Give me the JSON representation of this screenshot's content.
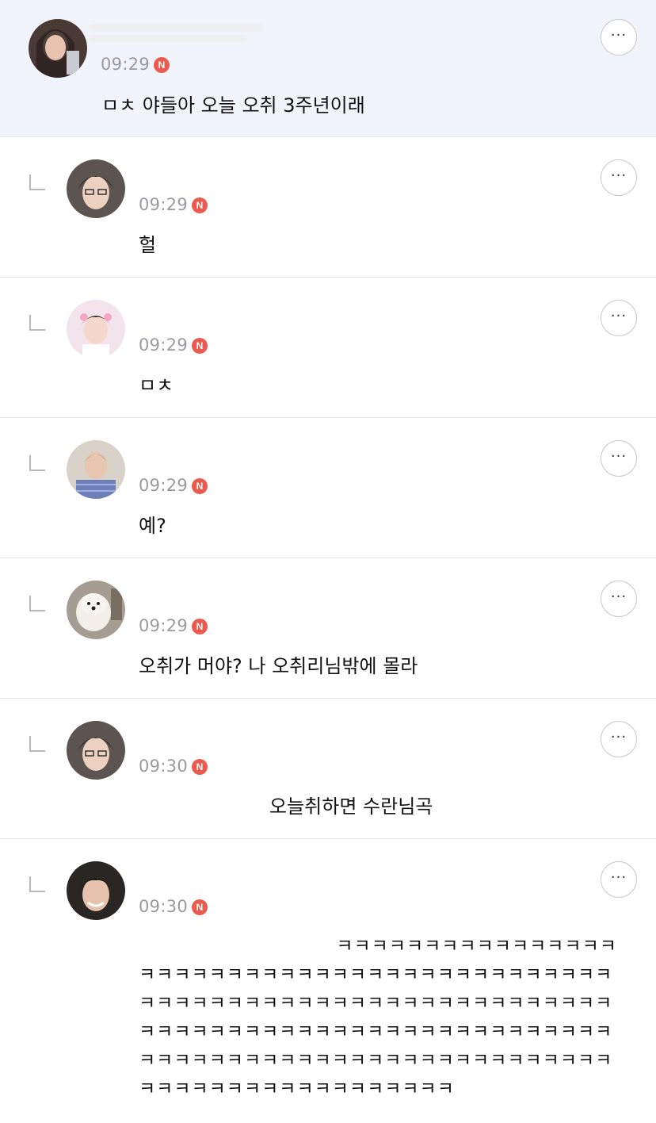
{
  "comments": [
    {
      "time": "09:29",
      "badge": "N",
      "text": "ㅁㅊ 야들아 오늘 오취 3주년이래",
      "more": "···"
    },
    {
      "time": "09:29",
      "badge": "N",
      "text": "헐",
      "more": "···"
    },
    {
      "time": "09:29",
      "badge": "N",
      "text": "ㅁㅊ",
      "more": "···"
    },
    {
      "time": "09:29",
      "badge": "N",
      "text": "예?",
      "more": "···"
    },
    {
      "time": "09:29",
      "badge": "N",
      "text": "오취가 머야? 나 오취리님밖에 몰라",
      "more": "···"
    },
    {
      "time": "09:30",
      "badge": "N",
      "text": "오늘취하면 수란님곡",
      "more": "···"
    },
    {
      "time": "09:30",
      "badge": "N",
      "text": "                              ㅋㅋㅋㅋㅋㅋㅋㅋㅋㅋㅋㅋㅋㅋㅋㅋㅋㅋㅋㅋㅋㅋㅋㅋㅋㅋㅋㅋㅋㅋㅋㅋㅋㅋㅋㅋㅋㅋㅋㅋㅋㅋㅋㅋㅋㅋㅋㅋㅋㅋㅋㅋㅋㅋㅋㅋㅋㅋㅋㅋㅋㅋㅋㅋㅋㅋㅋㅋㅋㅋㅋㅋㅋㅋㅋㅋㅋㅋㅋㅋㅋㅋㅋㅋㅋㅋㅋㅋㅋㅋㅋㅋㅋㅋㅋㅋㅋㅋㅋㅋㅋㅋㅋㅋㅋㅋㅋㅋㅋㅋㅋㅋㅋㅋㅋㅋㅋㅋㅋㅋㅋㅋㅋㅋㅋㅋㅋㅋㅋㅋㅋㅋㅋㅋㅋㅋㅋㅋㅋㅋㅋㅋ",
      "more": "···"
    }
  ],
  "colors": {
    "badge": "#ea5a4f",
    "highlight": "#f2f4fb",
    "divider": "#e3e3e6"
  }
}
